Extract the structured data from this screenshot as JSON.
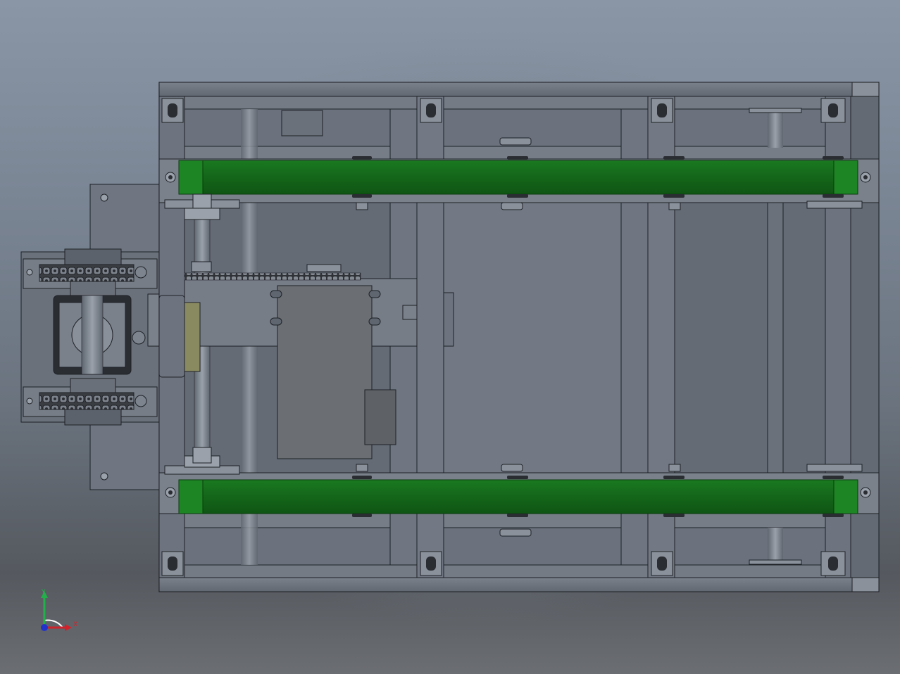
{
  "view": {
    "type": "cad-3d-viewport",
    "colors": {
      "frame": "#6e7580",
      "frame_dark": "#4a4f57",
      "belt": "#176d1c",
      "belt_highlight": "#1f8a26",
      "outline": "#1e2126",
      "motor": "#6b6e72",
      "plate": "#7d848e",
      "pad": "#8a8a60"
    }
  },
  "triad": {
    "x_label": "X",
    "y_label": "Y",
    "x_color": "#d0222a",
    "y_color": "#22b04a",
    "z_color": "#2233cc"
  }
}
